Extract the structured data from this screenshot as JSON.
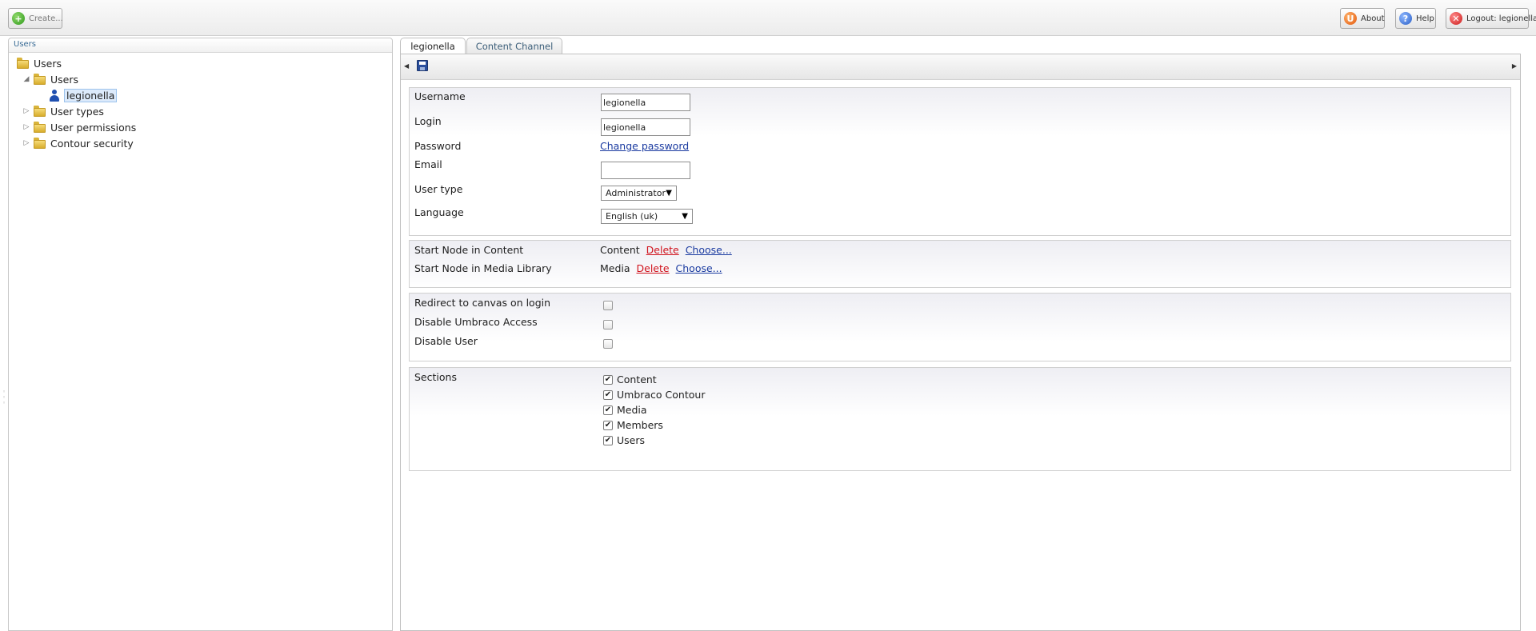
{
  "toolbar": {
    "create_label": "Create...",
    "about_label": "About",
    "help_label": "Help",
    "logout_label": "Logout: legionella"
  },
  "tree": {
    "header": "Users",
    "nodes": [
      {
        "label": "Users",
        "icon": "folder-icon",
        "expanded": true
      },
      {
        "label": "Users",
        "icon": "folder-icon",
        "expanded": true
      },
      {
        "label": "legionella",
        "icon": "user-icon",
        "selected": true
      },
      {
        "label": "User types",
        "icon": "folder-icon",
        "expanded": false
      },
      {
        "label": "User permissions",
        "icon": "folder-icon",
        "expanded": false
      },
      {
        "label": "Contour security",
        "icon": "folder-icon",
        "expanded": false
      }
    ]
  },
  "tabs": [
    {
      "label": "legionella",
      "active": true
    },
    {
      "label": "Content Channel",
      "active": false
    }
  ],
  "form": {
    "username": {
      "label": "Username",
      "value": "legionella"
    },
    "login": {
      "label": "Login",
      "value": "legionella"
    },
    "password": {
      "label": "Password",
      "link": "Change password"
    },
    "email": {
      "label": "Email",
      "value": ""
    },
    "user_type": {
      "label": "User type",
      "value": "Administrator"
    },
    "language": {
      "label": "Language",
      "value": "English (uk)"
    },
    "start_content": {
      "label": "Start Node in Content",
      "node": "Content",
      "delete": "Delete",
      "choose": "Choose..."
    },
    "start_media": {
      "label": "Start Node in Media Library",
      "node": "Media",
      "delete": "Delete",
      "choose": "Choose..."
    },
    "redirect": {
      "label": "Redirect to canvas on login",
      "checked": false
    },
    "disable_access": {
      "label": "Disable Umbraco Access",
      "checked": false
    },
    "disable_user": {
      "label": "Disable User",
      "checked": false
    },
    "sections": {
      "label": "Sections",
      "items": [
        {
          "label": "Content",
          "checked": true
        },
        {
          "label": "Umbraco Contour",
          "checked": true
        },
        {
          "label": "Media",
          "checked": true
        },
        {
          "label": "Members",
          "checked": true
        },
        {
          "label": "Users",
          "checked": true
        }
      ]
    }
  },
  "colors": {
    "link": "#1a3aa0",
    "delete": "#d0131d",
    "selection": "#dceafb"
  }
}
